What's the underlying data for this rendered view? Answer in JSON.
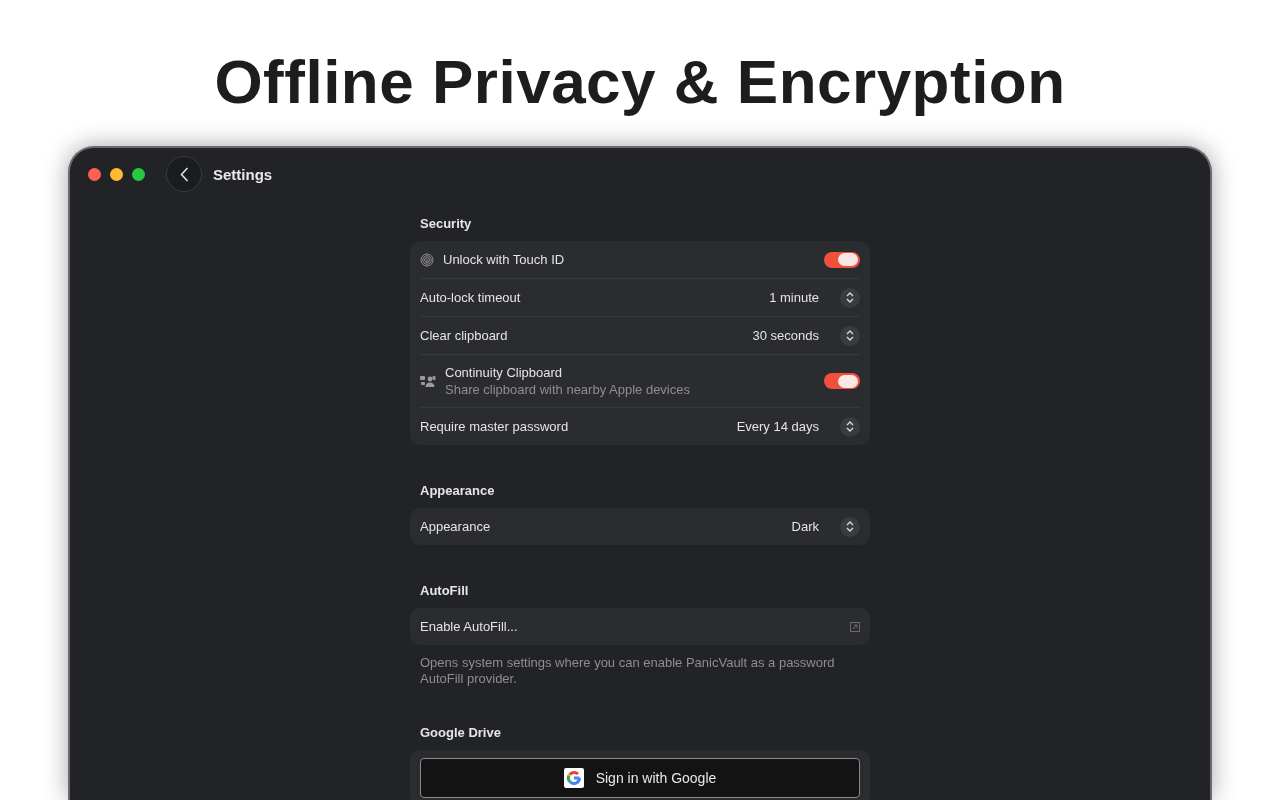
{
  "headline": "Offline Privacy & Encryption",
  "window": {
    "title": "Settings"
  },
  "sections": [
    {
      "title": "Security",
      "rows": [
        {
          "kind": "toggle",
          "label": "Unlock with Touch ID",
          "on": true
        },
        {
          "kind": "select",
          "label": "Auto-lock timeout",
          "value": "1 minute"
        },
        {
          "kind": "select",
          "label": "Clear clipboard",
          "value": "30 seconds"
        },
        {
          "kind": "toggle",
          "label": "Continuity Clipboard",
          "subtitle": "Share clipboard with nearby Apple devices",
          "on": true
        },
        {
          "kind": "select",
          "label": "Require master password",
          "value": "Every 14 days"
        }
      ]
    },
    {
      "title": "Appearance",
      "rows": [
        {
          "kind": "select",
          "label": "Appearance",
          "value": "Dark"
        }
      ]
    },
    {
      "title": "AutoFill",
      "rows": [
        {
          "kind": "link",
          "label": "Enable AutoFill..."
        }
      ],
      "note": "Opens system settings where you can enable PanicVault as a password AutoFill provider."
    },
    {
      "title": "Google Drive",
      "rows": [
        {
          "kind": "google",
          "label": "Sign in with Google"
        }
      ]
    }
  ]
}
